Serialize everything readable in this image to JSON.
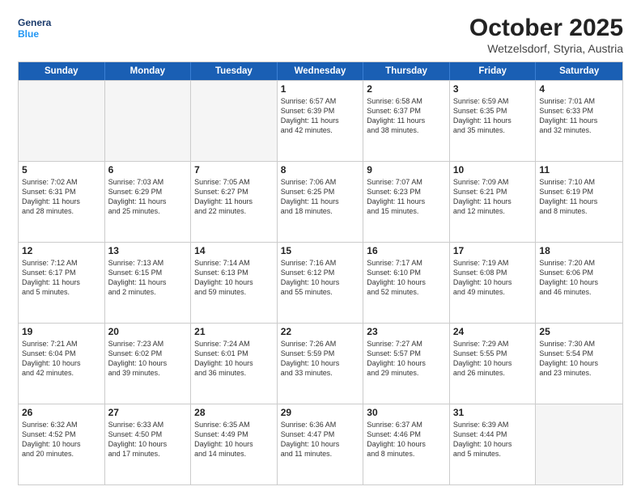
{
  "logo": {
    "line1": "General",
    "line2": "Blue"
  },
  "title": "October 2025",
  "location": "Wetzelsdorf, Styria, Austria",
  "days_of_week": [
    "Sunday",
    "Monday",
    "Tuesday",
    "Wednesday",
    "Thursday",
    "Friday",
    "Saturday"
  ],
  "weeks": [
    [
      {
        "day": "",
        "text": ""
      },
      {
        "day": "",
        "text": ""
      },
      {
        "day": "",
        "text": ""
      },
      {
        "day": "1",
        "text": "Sunrise: 6:57 AM\nSunset: 6:39 PM\nDaylight: 11 hours\nand 42 minutes."
      },
      {
        "day": "2",
        "text": "Sunrise: 6:58 AM\nSunset: 6:37 PM\nDaylight: 11 hours\nand 38 minutes."
      },
      {
        "day": "3",
        "text": "Sunrise: 6:59 AM\nSunset: 6:35 PM\nDaylight: 11 hours\nand 35 minutes."
      },
      {
        "day": "4",
        "text": "Sunrise: 7:01 AM\nSunset: 6:33 PM\nDaylight: 11 hours\nand 32 minutes."
      }
    ],
    [
      {
        "day": "5",
        "text": "Sunrise: 7:02 AM\nSunset: 6:31 PM\nDaylight: 11 hours\nand 28 minutes."
      },
      {
        "day": "6",
        "text": "Sunrise: 7:03 AM\nSunset: 6:29 PM\nDaylight: 11 hours\nand 25 minutes."
      },
      {
        "day": "7",
        "text": "Sunrise: 7:05 AM\nSunset: 6:27 PM\nDaylight: 11 hours\nand 22 minutes."
      },
      {
        "day": "8",
        "text": "Sunrise: 7:06 AM\nSunset: 6:25 PM\nDaylight: 11 hours\nand 18 minutes."
      },
      {
        "day": "9",
        "text": "Sunrise: 7:07 AM\nSunset: 6:23 PM\nDaylight: 11 hours\nand 15 minutes."
      },
      {
        "day": "10",
        "text": "Sunrise: 7:09 AM\nSunset: 6:21 PM\nDaylight: 11 hours\nand 12 minutes."
      },
      {
        "day": "11",
        "text": "Sunrise: 7:10 AM\nSunset: 6:19 PM\nDaylight: 11 hours\nand 8 minutes."
      }
    ],
    [
      {
        "day": "12",
        "text": "Sunrise: 7:12 AM\nSunset: 6:17 PM\nDaylight: 11 hours\nand 5 minutes."
      },
      {
        "day": "13",
        "text": "Sunrise: 7:13 AM\nSunset: 6:15 PM\nDaylight: 11 hours\nand 2 minutes."
      },
      {
        "day": "14",
        "text": "Sunrise: 7:14 AM\nSunset: 6:13 PM\nDaylight: 10 hours\nand 59 minutes."
      },
      {
        "day": "15",
        "text": "Sunrise: 7:16 AM\nSunset: 6:12 PM\nDaylight: 10 hours\nand 55 minutes."
      },
      {
        "day": "16",
        "text": "Sunrise: 7:17 AM\nSunset: 6:10 PM\nDaylight: 10 hours\nand 52 minutes."
      },
      {
        "day": "17",
        "text": "Sunrise: 7:19 AM\nSunset: 6:08 PM\nDaylight: 10 hours\nand 49 minutes."
      },
      {
        "day": "18",
        "text": "Sunrise: 7:20 AM\nSunset: 6:06 PM\nDaylight: 10 hours\nand 46 minutes."
      }
    ],
    [
      {
        "day": "19",
        "text": "Sunrise: 7:21 AM\nSunset: 6:04 PM\nDaylight: 10 hours\nand 42 minutes."
      },
      {
        "day": "20",
        "text": "Sunrise: 7:23 AM\nSunset: 6:02 PM\nDaylight: 10 hours\nand 39 minutes."
      },
      {
        "day": "21",
        "text": "Sunrise: 7:24 AM\nSunset: 6:01 PM\nDaylight: 10 hours\nand 36 minutes."
      },
      {
        "day": "22",
        "text": "Sunrise: 7:26 AM\nSunset: 5:59 PM\nDaylight: 10 hours\nand 33 minutes."
      },
      {
        "day": "23",
        "text": "Sunrise: 7:27 AM\nSunset: 5:57 PM\nDaylight: 10 hours\nand 29 minutes."
      },
      {
        "day": "24",
        "text": "Sunrise: 7:29 AM\nSunset: 5:55 PM\nDaylight: 10 hours\nand 26 minutes."
      },
      {
        "day": "25",
        "text": "Sunrise: 7:30 AM\nSunset: 5:54 PM\nDaylight: 10 hours\nand 23 minutes."
      }
    ],
    [
      {
        "day": "26",
        "text": "Sunrise: 6:32 AM\nSunset: 4:52 PM\nDaylight: 10 hours\nand 20 minutes."
      },
      {
        "day": "27",
        "text": "Sunrise: 6:33 AM\nSunset: 4:50 PM\nDaylight: 10 hours\nand 17 minutes."
      },
      {
        "day": "28",
        "text": "Sunrise: 6:35 AM\nSunset: 4:49 PM\nDaylight: 10 hours\nand 14 minutes."
      },
      {
        "day": "29",
        "text": "Sunrise: 6:36 AM\nSunset: 4:47 PM\nDaylight: 10 hours\nand 11 minutes."
      },
      {
        "day": "30",
        "text": "Sunrise: 6:37 AM\nSunset: 4:46 PM\nDaylight: 10 hours\nand 8 minutes."
      },
      {
        "day": "31",
        "text": "Sunrise: 6:39 AM\nSunset: 4:44 PM\nDaylight: 10 hours\nand 5 minutes."
      },
      {
        "day": "",
        "text": ""
      }
    ]
  ]
}
